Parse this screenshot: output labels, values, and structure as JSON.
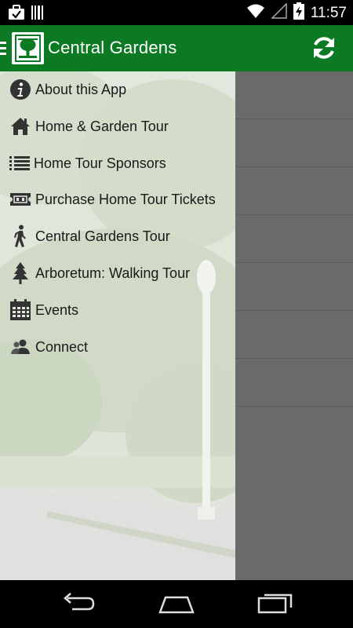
{
  "status": {
    "time": "11:57",
    "left_icons": [
      "briefcase-check-icon",
      "barcode-icon"
    ],
    "right_icons": [
      "wifi-icon",
      "signal-icon",
      "battery-charging-icon"
    ]
  },
  "app_bar": {
    "title": "Central Gardens",
    "background": "#0b7a22",
    "icons": [
      "menu-icon",
      "garden-logo",
      "refresh-icon"
    ]
  },
  "drawer": {
    "items": [
      {
        "label": "About this App",
        "icon": "info-icon"
      },
      {
        "label": "Home & Garden Tour",
        "icon": "home-icon"
      },
      {
        "label": "Home Tour Sponsors",
        "icon": "list-icon"
      },
      {
        "label": "Purchase Home Tour Tickets",
        "icon": "ticket-icon"
      },
      {
        "label": "Central Gardens Tour",
        "icon": "walking-icon"
      },
      {
        "label": "Arboretum: Walking Tour",
        "icon": "tree-icon"
      },
      {
        "label": "Events",
        "icon": "calendar-icon"
      },
      {
        "label": "Connect",
        "icon": "people-icon"
      }
    ]
  },
  "nav_bar": {
    "buttons": [
      "back-icon",
      "home-icon",
      "recents-icon"
    ]
  }
}
